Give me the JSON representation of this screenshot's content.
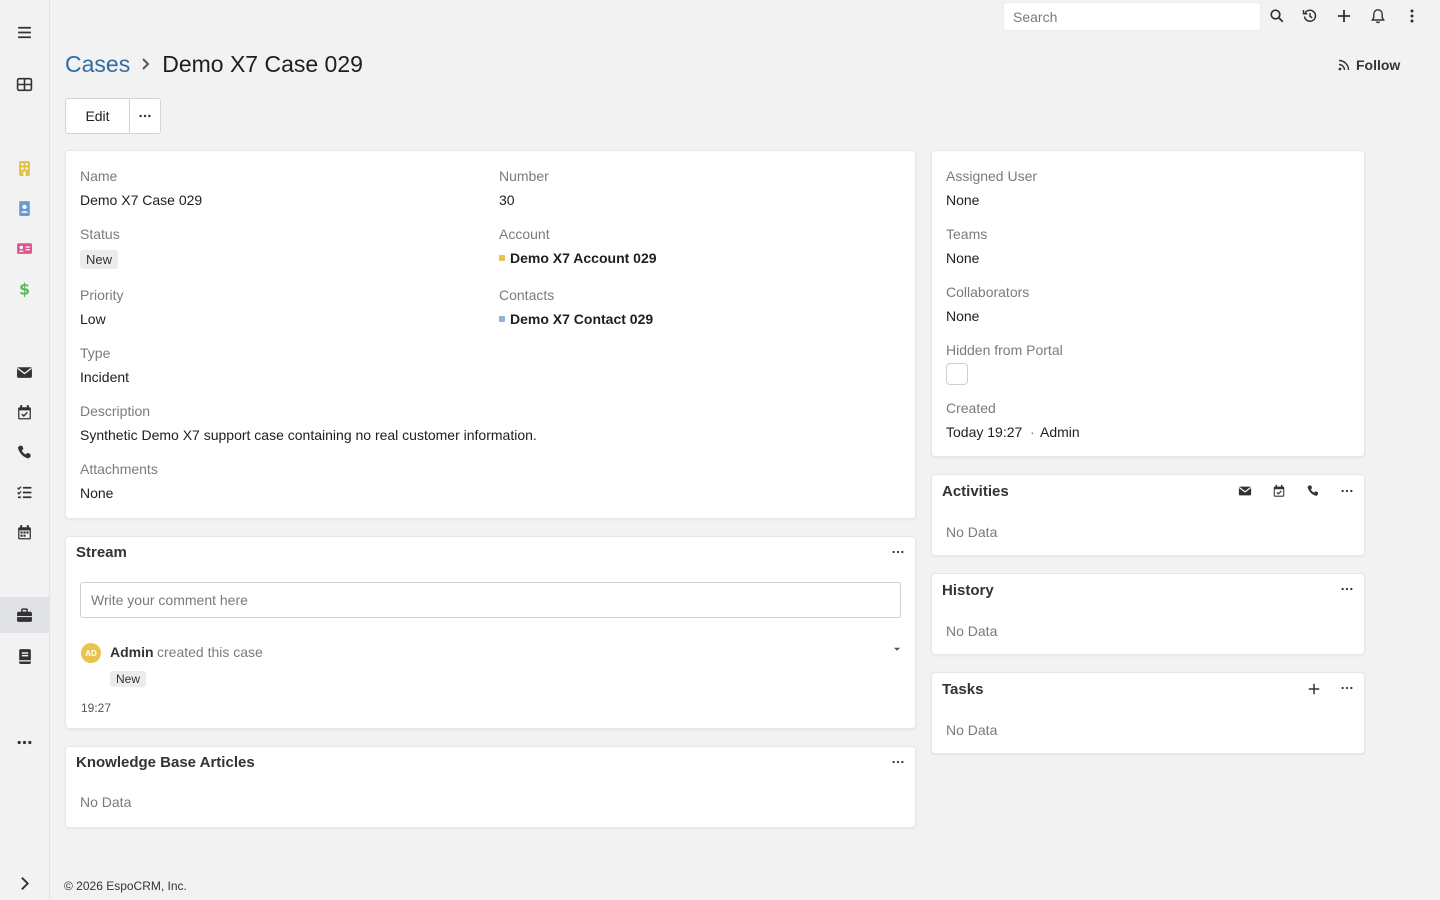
{
  "navbar": {
    "search_placeholder": "Search"
  },
  "header": {
    "breadcrumb_parent": "Cases",
    "title": "Demo X7 Case 029",
    "follow_label": "Follow"
  },
  "actions": {
    "edit_label": "Edit"
  },
  "detail": {
    "name_label": "Name",
    "name_value": "Demo X7 Case 029",
    "number_label": "Number",
    "number_value": "30",
    "status_label": "Status",
    "status_value": "New",
    "account_label": "Account",
    "account_value": "Demo X7 Account 029",
    "account_color": "#e8c34f",
    "priority_label": "Priority",
    "priority_value": "Low",
    "contacts_label": "Contacts",
    "contacts_value": "Demo X7 Contact 029",
    "contact_color": "#8fb3d6",
    "type_label": "Type",
    "type_value": "Incident",
    "description_label": "Description",
    "description_value": "Synthetic Demo X7 support case containing no real customer information.",
    "attachments_label": "Attachments",
    "attachments_value": "None"
  },
  "side_detail": {
    "assigned_user_label": "Assigned User",
    "assigned_user_value": "None",
    "teams_label": "Teams",
    "teams_value": "None",
    "collaborators_label": "Collaborators",
    "collaborators_value": "None",
    "hidden_label": "Hidden from Portal",
    "created_label": "Created",
    "created_time": "Today 19:27",
    "created_sep": "·",
    "created_by": "Admin"
  },
  "stream": {
    "title": "Stream",
    "comment_placeholder": "Write your comment here",
    "entry": {
      "avatar_initials": "AD",
      "user": "Admin",
      "action": "created this case",
      "status": "New",
      "time": "19:27"
    }
  },
  "kb": {
    "title": "Knowledge Base Articles",
    "empty": "No Data"
  },
  "activities": {
    "title": "Activities",
    "empty": "No Data"
  },
  "history": {
    "title": "History",
    "empty": "No Data"
  },
  "tasks": {
    "title": "Tasks",
    "empty": "No Data"
  },
  "footer": {
    "text": "© 2026 EspoCRM, Inc."
  },
  "sidebar": {
    "items": [
      {
        "icon": "menu-icon"
      },
      {
        "icon": "dashboard-icon"
      },
      {
        "icon": "accounts-icon"
      },
      {
        "icon": "contacts-icon"
      },
      {
        "icon": "leads-icon"
      },
      {
        "icon": "opportunities-icon"
      },
      {
        "icon": "email-icon"
      },
      {
        "icon": "meetings-icon"
      },
      {
        "icon": "calls-icon"
      },
      {
        "icon": "tasks-icon"
      },
      {
        "icon": "calendar-icon"
      },
      {
        "icon": "cases-icon"
      },
      {
        "icon": "knowledge-base-icon"
      },
      {
        "icon": "more-icon"
      },
      {
        "icon": "expand-icon"
      }
    ]
  }
}
